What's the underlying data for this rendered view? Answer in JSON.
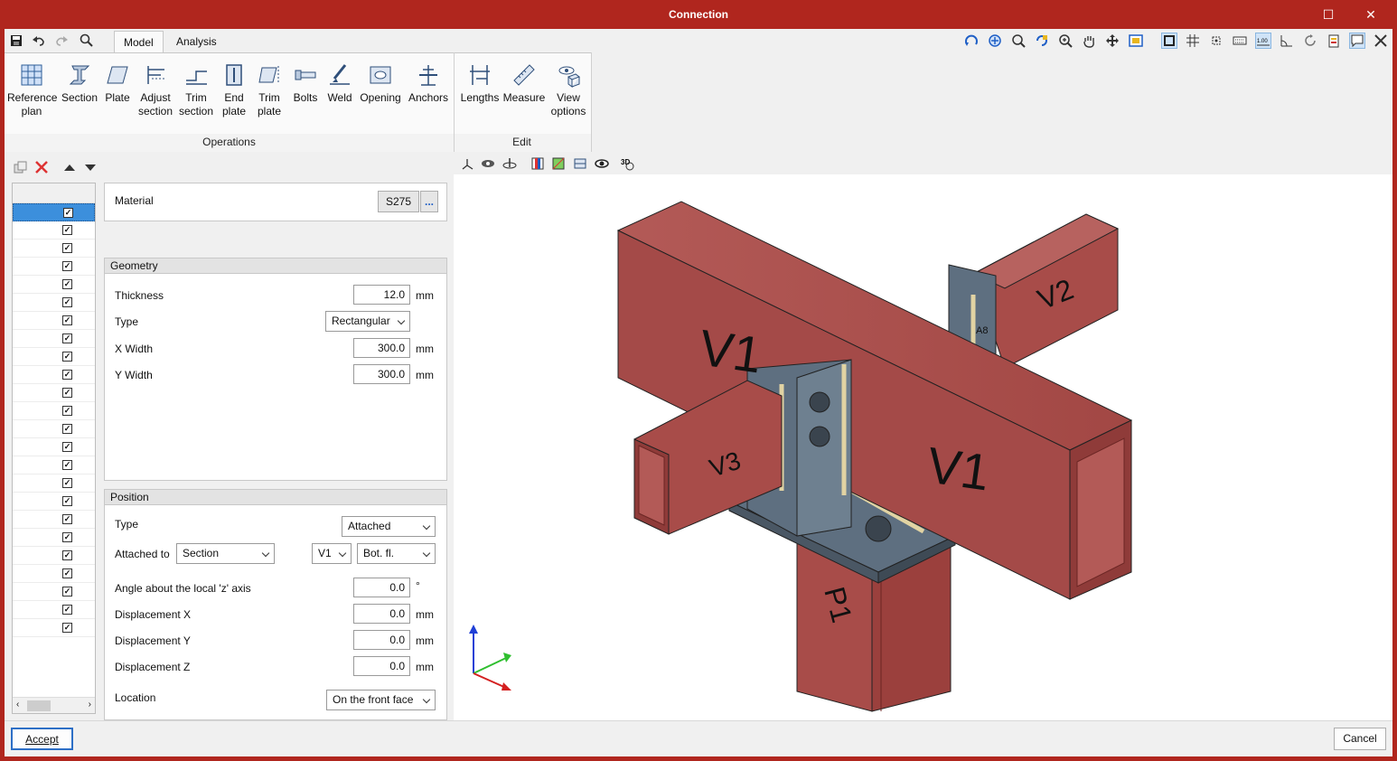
{
  "window": {
    "title": "Connection",
    "minimize_glyph": "—",
    "maximize_glyph": "☐",
    "close_glyph": "✕"
  },
  "tabs": [
    {
      "label": "Model"
    },
    {
      "label": "Analysis"
    }
  ],
  "ribbon": {
    "groups": [
      {
        "label": "Operations"
      },
      {
        "label": "Edit"
      }
    ],
    "operations": [
      {
        "label": "Reference\nplan",
        "icon": "grid-plan-icon"
      },
      {
        "label": "Section",
        "icon": "i-beam-icon"
      },
      {
        "label": "Plate",
        "icon": "plate-icon"
      },
      {
        "label": "Adjust\nsection",
        "icon": "adjust-section-icon"
      },
      {
        "label": "Trim\nsection",
        "icon": "trim-section-icon"
      },
      {
        "label": "End\nplate",
        "icon": "end-plate-icon"
      },
      {
        "label": "Trim\nplate",
        "icon": "trim-plate-icon"
      },
      {
        "label": "Bolts",
        "icon": "bolts-icon"
      },
      {
        "label": "Weld",
        "icon": "weld-icon"
      },
      {
        "label": "Opening",
        "icon": "opening-icon"
      },
      {
        "label": "Anchors",
        "icon": "anchors-icon"
      }
    ],
    "edit": [
      {
        "label": "Lengths",
        "icon": "lengths-icon"
      },
      {
        "label": "Measure",
        "icon": "measure-icon"
      },
      {
        "label": "View\noptions",
        "icon": "view-options-icon"
      }
    ]
  },
  "form": {
    "material": {
      "label": "Material",
      "value": "S275",
      "more": "..."
    },
    "geometry": {
      "title": "Geometry",
      "thickness": {
        "label": "Thickness",
        "value": "12.0",
        "unit": "mm"
      },
      "type": {
        "label": "Type",
        "value": "Rectangular"
      },
      "x_width": {
        "label": "X Width",
        "value": "300.0",
        "unit": "mm"
      },
      "y_width": {
        "label": "Y Width",
        "value": "300.0",
        "unit": "mm"
      }
    },
    "position": {
      "title": "Position",
      "type": {
        "label": "Type",
        "value": "Attached"
      },
      "attached_to": {
        "label": "Attached to",
        "value": "Section",
        "member": "V1",
        "face": "Bot. fl."
      },
      "angle": {
        "label": "Angle about the local 'z' axis",
        "value": "0.0",
        "unit": "°"
      },
      "disp_x": {
        "label": "Displacement X",
        "value": "0.0",
        "unit": "mm"
      },
      "disp_y": {
        "label": "Displacement Y",
        "value": "0.0",
        "unit": "mm"
      },
      "disp_z": {
        "label": "Displacement Z",
        "value": "0.0",
        "unit": "mm"
      },
      "location": {
        "label": "Location",
        "value": "On the front face"
      }
    }
  },
  "list": {
    "rows": 24,
    "checked": true
  },
  "model": {
    "labels": [
      "V1",
      "V1",
      "V2",
      "V3",
      "P1",
      "A8"
    ],
    "member_color": "#a44a48"
  },
  "footer": {
    "accept": "Accept",
    "cancel": "Cancel"
  }
}
